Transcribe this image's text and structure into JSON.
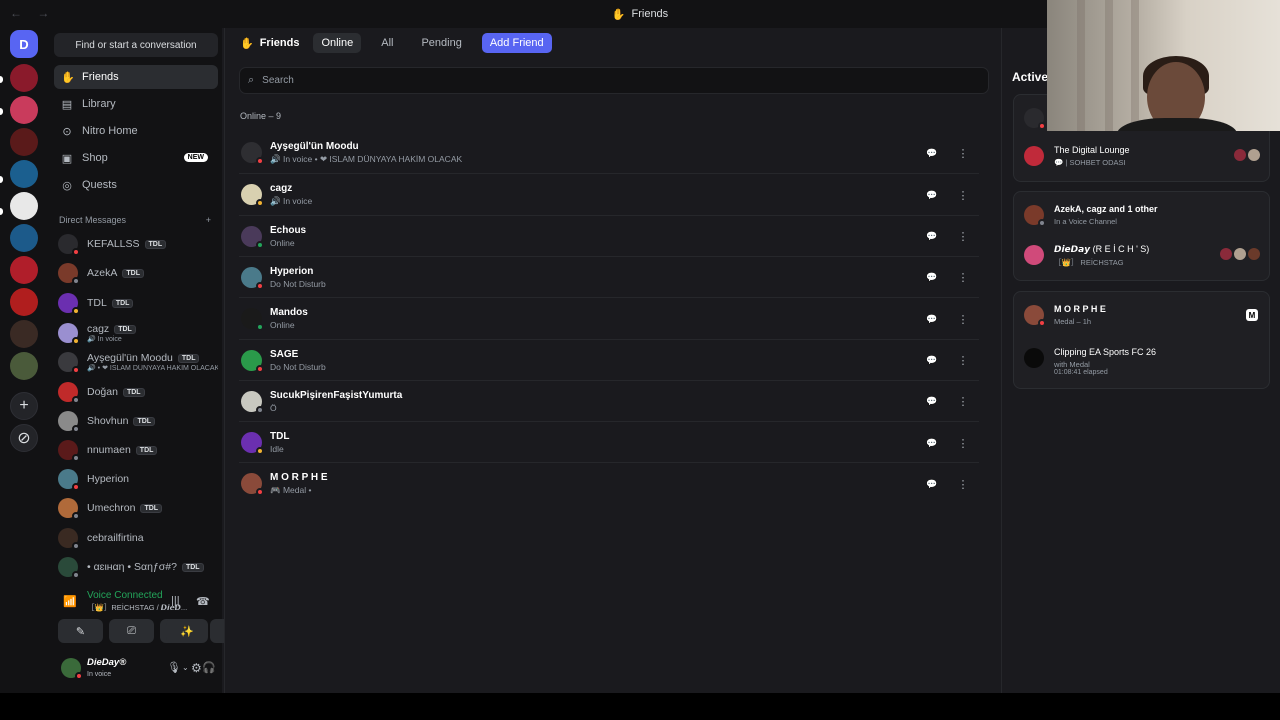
{
  "window": {
    "title": "Friends",
    "nav": "← →"
  },
  "rail": {
    "home_label": "D",
    "servers": [
      {
        "color": "#8a1a2b"
      },
      {
        "color": "#c93b5c"
      },
      {
        "color": "#5a1a1a"
      },
      {
        "color": "#1b5f8f"
      },
      {
        "color": "#e8e8e8"
      },
      {
        "color": "#1c5a8a"
      },
      {
        "color": "#b01e2a"
      },
      {
        "color": "#b01e1e"
      },
      {
        "color": "#3a2a24"
      },
      {
        "color": "#4a5a3a"
      }
    ],
    "add_icon": "+",
    "discover_icon": "⊘"
  },
  "sidebar": {
    "find_label": "Find or start a conversation",
    "nav": [
      {
        "label": "Friends",
        "icon": "✋"
      },
      {
        "label": "Library",
        "icon": "▤"
      },
      {
        "label": "Nitro Home",
        "icon": "⊙"
      },
      {
        "label": "Shop",
        "icon": "▣"
      },
      {
        "label": "Quests",
        "icon": "◎"
      }
    ],
    "shop_badge": "NEW",
    "dm_header": "Direct Messages",
    "dm_add": "+",
    "dms": [
      {
        "name": "KEFALLSS",
        "tag": "TDL",
        "sub": "",
        "color": "#2a2a2e",
        "status": "dnd"
      },
      {
        "name": "AzekA",
        "tag": "TDL",
        "sub": "",
        "color": "#7a3a2a",
        "status": "off"
      },
      {
        "name": "TDL",
        "tag": "TDL",
        "sub": "",
        "color": "#6b2fb0",
        "status": "idle"
      },
      {
        "name": "cagz",
        "tag": "TDL",
        "sub": "In voice",
        "color": "#9a8fd0",
        "status": "idle"
      },
      {
        "name": "Ayşegül'ün Moodu",
        "tag": "TDL",
        "sub": "• ❤ ISLAM DÜNYAYA HAKİM OLACAK",
        "color": "#3a3a3e",
        "status": "dnd"
      },
      {
        "name": "Doğan",
        "tag": "TDL",
        "sub": "",
        "color": "#c02a2a",
        "status": "off"
      },
      {
        "name": "Shovhun",
        "tag": "TDL",
        "sub": "",
        "color": "#8a8a8a",
        "status": "off"
      },
      {
        "name": "nnumaen",
        "tag": "TDL",
        "sub": "",
        "color": "#5a1a1a",
        "status": "off"
      },
      {
        "name": "Hyperion",
        "tag": "",
        "sub": "",
        "color": "#4a7a8a",
        "status": "dnd"
      },
      {
        "name": "Umechron",
        "tag": "TDL",
        "sub": "",
        "color": "#b06a3a",
        "status": "off"
      },
      {
        "name": "cebrailfirtina",
        "tag": "",
        "sub": "",
        "color": "#3a2a22",
        "status": "off"
      },
      {
        "name": "• αɛιнαη • Sαηƒσ#?",
        "tag": "TDL",
        "sub": "",
        "color": "#2a4a3a",
        "status": "off"
      }
    ],
    "voice": {
      "title": "Voice Connected",
      "sub": "［👑］REİCHSTAG / 𝘿𝙞𝙚𝘿...",
      "buttons": [
        "✎",
        "⎚",
        "⁘",
        "✨"
      ]
    },
    "user": {
      "name": "DieDay®",
      "sub": "In voice"
    }
  },
  "main": {
    "title": "Friends",
    "tabs": [
      "Online",
      "All",
      "Pending"
    ],
    "add_friend": "Add Friend",
    "search_placeholder": "Search",
    "online_count": "Online – 9",
    "friends": [
      {
        "name": "Ayşegül'ün Moodu",
        "sub": "In voice • ❤ ISLAM DÜNYAYA HAKİM OLACAK",
        "color": "#2e2e32",
        "status": "dnd"
      },
      {
        "name": "cagz",
        "sub": "In voice",
        "color": "#d8d0b0",
        "status": "idle"
      },
      {
        "name": "Echous",
        "sub": "Online",
        "color": "#4a3a5a",
        "status": "on"
      },
      {
        "name": "Hyperion",
        "sub": "Do Not Disturb",
        "color": "#4a7a8a",
        "status": "dnd"
      },
      {
        "name": "Mandos",
        "sub": "Online",
        "color": "#1a1a1a",
        "status": "on"
      },
      {
        "name": "SAGE",
        "sub": "Do Not Disturb",
        "color": "#2a9a4a",
        "status": "dnd"
      },
      {
        "name": "SucukPişirenFaşistYumurta",
        "sub": "Ö",
        "color": "#c8c8c0",
        "status": "off"
      },
      {
        "name": "TDL",
        "sub": "Idle",
        "color": "#6b2fb0",
        "status": "idle"
      },
      {
        "name": "M O R P H E",
        "sub": "Medal • ",
        "color": "#8a4a3a",
        "status": "dnd"
      }
    ]
  },
  "active": {
    "title": "Active",
    "cards": [
      {
        "rows": [
          {
            "title": "",
            "sub": "",
            "color": "#2a2a2e",
            "status": "dnd"
          },
          {
            "title": "The Digital Lounge",
            "sub": "💬 | SOHBET ODASI",
            "color": "#c02a3a",
            "status": ""
          }
        ]
      },
      {
        "rows": [
          {
            "title": "AzekA, cagz and 1 other",
            "sub": "In a Voice Channel",
            "color": "#7a3a2a",
            "status": "off"
          },
          {
            "title": "𝘿𝙞𝙚𝘿𝙖𝙮 (R E İ C H ' S)",
            "sub": "［👑］ REİCHSTAG",
            "color": "#d04a7a",
            "status": ""
          }
        ]
      },
      {
        "rows": [
          {
            "title": "M O R P H E",
            "sub": "Medal – 1h",
            "color": "#8a4a3a",
            "status": "dnd"
          },
          {
            "title": "Clipping EA Sports FC 26",
            "sub": "with Medal",
            "sub2": "01:08:41 elapsed",
            "color": "#0a0a0a",
            "status": ""
          }
        ]
      }
    ],
    "medal_icon": "M"
  },
  "icons": {
    "chat": "message-icon",
    "more": "more-vertical-icon"
  }
}
